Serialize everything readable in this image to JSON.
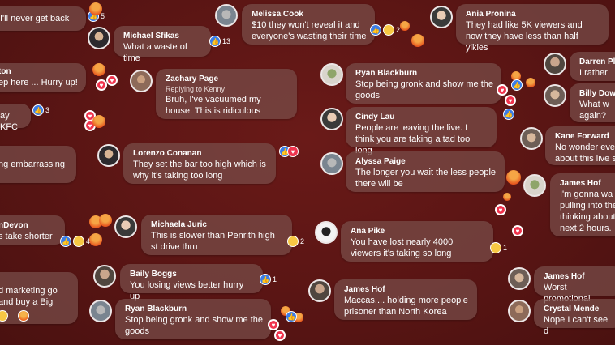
{
  "comments": [
    {
      "name": "",
      "text": "I'll never get back",
      "reaction_count": "5"
    },
    {
      "name": "Michael Sfikas",
      "text": "What a waste of time",
      "reaction_count": "13"
    },
    {
      "name": "Melissa Cook",
      "text": "$10 they won't reveal it and everyone's wasting their time",
      "reaction_count": "2"
    },
    {
      "name": "Ania Pronina",
      "text": "They had like 5K viewers and now they have less than half yikies"
    },
    {
      "name": "ton",
      "text": "ep here ... Hurry up!"
    },
    {
      "name": "Zachary Page",
      "subtext": "Replying to Kenny",
      "text": "Bruh, I've vacuumed my house. This is ridiculous"
    },
    {
      "name": "Ryan Blackburn",
      "text": "Stop being gronk and show me the goods"
    },
    {
      "name": "Darren Plo",
      "text": "I rather"
    },
    {
      "name": "Billy Dowli",
      "text": "What w again?"
    },
    {
      "name": "",
      "text": "ay KFC",
      "reaction_count": "3"
    },
    {
      "name": "Cindy Lau",
      "text": "People are leaving the live. I think you are taking a tad too long"
    },
    {
      "name": "Kane Forward",
      "text": "No wonder ever about this live s"
    },
    {
      "name": "Lorenzo Conanan",
      "text": "They set the bar too high which is why it's taking too long"
    },
    {
      "name": "",
      "text": "ng embarrassing"
    },
    {
      "name": "Alyssa Paige",
      "text": "The longer you wait the less people there will be"
    },
    {
      "name": "James Hof",
      "text": "I'm gonna wa pulling into the thinking about next 2 hours."
    },
    {
      "name": "nDevon",
      "text": "s take shorter",
      "reaction_count": "4"
    },
    {
      "name": "Michaela Juric",
      "text": "This is slower than Penrith high st drive thru",
      "reaction_count": "2"
    },
    {
      "name": "Ana Pike",
      "text": "You have lost nearly 4000 viewers it's taking so long",
      "reaction_count": "1"
    },
    {
      "name": "Baily Boggs",
      "text": "You losing views better hurry up",
      "reaction_count": "1"
    },
    {
      "name": "James Hof",
      "text": "Worst promotional"
    },
    {
      "name": "",
      "text": "d marketing go and buy a Big"
    },
    {
      "name": "James Hof",
      "text": "Maccas.... holding more people prisoner than North Korea"
    },
    {
      "name": "Crystal Mende",
      "text": "Nope I can't see d"
    },
    {
      "name": "Ryan Blackburn",
      "text": "Stop being gronk and show me the goods"
    }
  ],
  "colors": {
    "background": "#5a1514",
    "bubble": "#7a4e4a",
    "like": "#3b7de8",
    "love": "#f0344e",
    "angry": "#ef6a21"
  },
  "icons": [
    "like-icon",
    "love-icon",
    "angry-icon",
    "haha-icon"
  ]
}
